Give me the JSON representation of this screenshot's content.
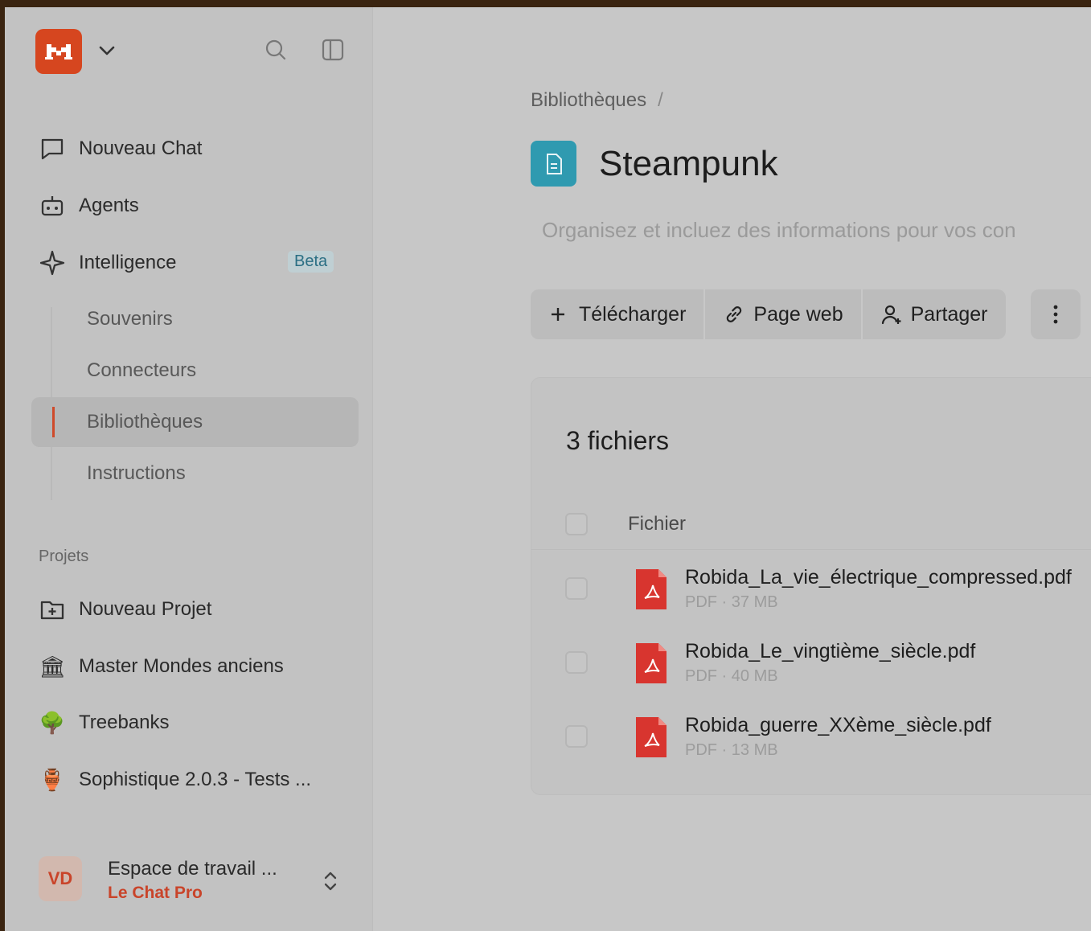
{
  "sidebar": {
    "logo_text": "M",
    "nav": [
      {
        "label": "Nouveau Chat",
        "icon": "chat-bubble-icon"
      },
      {
        "label": "Agents",
        "icon": "robot-icon"
      },
      {
        "label": "Intelligence",
        "icon": "sparkle-icon"
      }
    ],
    "beta_badge": "Beta",
    "sub_items": [
      "Souvenirs",
      "Connecteurs",
      "Bibliothèques",
      "Instructions"
    ],
    "active_sub_item": "Bibliothèques",
    "projects_label": "Projets",
    "projects": [
      {
        "label": "Nouveau Projet",
        "icon": "folder-plus-icon"
      },
      {
        "label": "Master Mondes anciens",
        "icon": "🏛"
      },
      {
        "label": "Treebanks",
        "icon": "🌳"
      },
      {
        "label": "Sophistique 2.0.3 - Tests ...",
        "icon": "🏺"
      }
    ],
    "workspace": {
      "initials": "VD",
      "name": "Espace de travail ...",
      "plan": "Le Chat Pro"
    }
  },
  "main": {
    "breadcrumb": "Bibliothèques",
    "breadcrumb_sep": "/",
    "title": "Steampunk",
    "description": "Organisez et incluez des informations pour vos con",
    "toolbar": {
      "upload": "Télécharger",
      "webpage": "Page web",
      "share": "Partager"
    },
    "files_count": "3 fichiers",
    "column_header": "Fichier",
    "files": [
      {
        "name": "Robida_La_vie_électrique_compressed.pdf",
        "meta": "PDF · 37 MB"
      },
      {
        "name": "Robida_Le_vingtième_siècle.pdf",
        "meta": "PDF · 40 MB"
      },
      {
        "name": "Robida_guerre_XXème_siècle.pdf",
        "meta": "PDF · 13 MB"
      }
    ]
  },
  "colors": {
    "accent": "#d6461f",
    "library_icon": "#2f9ab0",
    "pdf_red": "#d8352f"
  }
}
